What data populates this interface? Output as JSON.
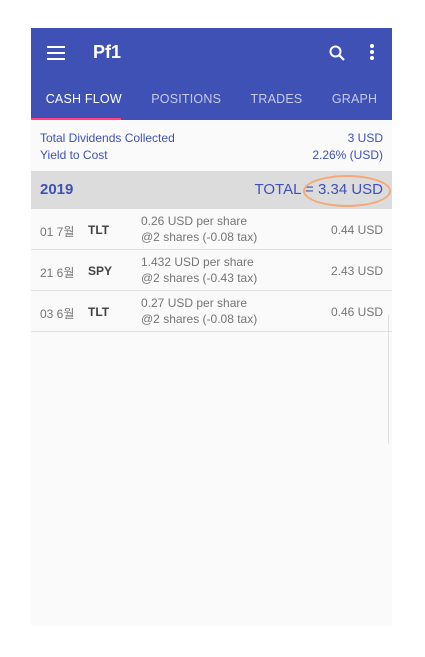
{
  "appbar": {
    "title": "Pf1",
    "menu_icon": "menu-icon",
    "search_icon": "search-icon",
    "more_icon": "more-vert-icon"
  },
  "tabs": [
    {
      "label": "CASH FLOW",
      "active": true
    },
    {
      "label": "POSITIONS",
      "active": false
    },
    {
      "label": "TRADES",
      "active": false
    },
    {
      "label": "GRAPH",
      "active": false
    }
  ],
  "summary": {
    "dividends_label": "Total Dividends Collected",
    "dividends_value": "3 USD",
    "yield_label": "Yield to Cost",
    "yield_value": "2.26% (USD)"
  },
  "year_section": {
    "year": "2019",
    "total": "TOTAL = 3.34 USD"
  },
  "rows": [
    {
      "date": "01 7월",
      "ticker": "TLT",
      "line1": "0.26 USD per share",
      "line2": "@2 shares (-0.08 tax)",
      "amount": "0.44 USD"
    },
    {
      "date": "21 6월",
      "ticker": "SPY",
      "line1": "1.432 USD per share",
      "line2": "@2 shares (-0.43 tax)",
      "amount": "2.43 USD"
    },
    {
      "date": "03 6월",
      "ticker": "TLT",
      "line1": "0.27 USD per share",
      "line2": "@2 shares (-0.08 tax)",
      "amount": "0.46 USD"
    }
  ],
  "colors": {
    "primary": "#3f51b5",
    "accent": "#ff4081",
    "highlight_circle": "#f4a97a"
  }
}
